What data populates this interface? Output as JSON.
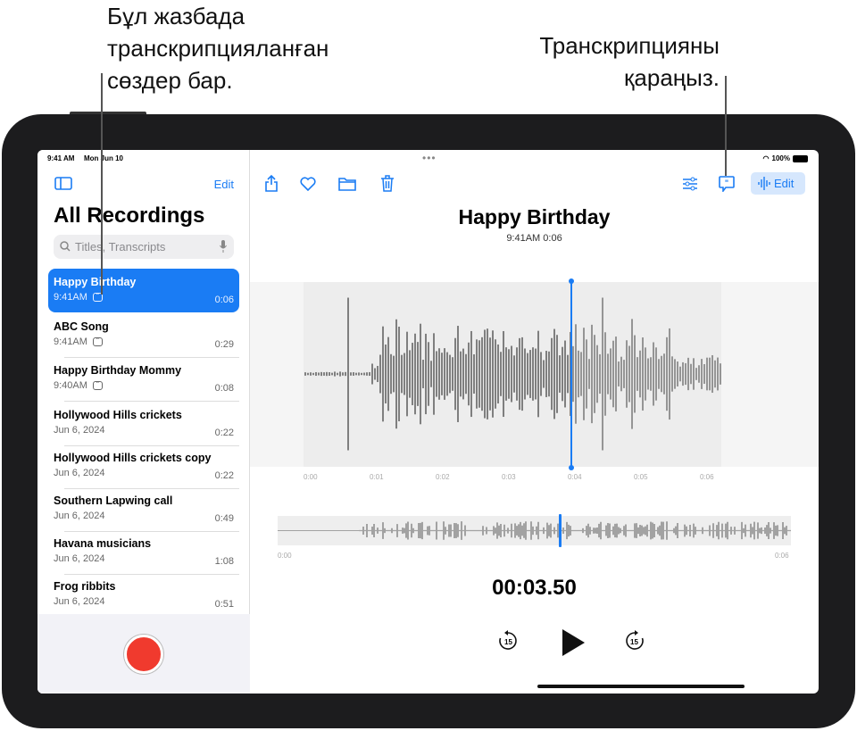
{
  "callouts": {
    "left": [
      "Бұл жазбада",
      "транскрипцияланған",
      "сөздер бар."
    ],
    "right": [
      "Транскрипцияны",
      "қараңыз."
    ]
  },
  "status": {
    "time": "9:41 AM",
    "date": "Mon Jun 10",
    "battery": "100%"
  },
  "sidebar": {
    "edit": "Edit",
    "title": "All Recordings",
    "search_placeholder": "Titles, Transcripts",
    "items": [
      {
        "title": "Happy Birthday",
        "sub": "9:41AM",
        "duration": "0:06",
        "transcript": true,
        "selected": true
      },
      {
        "title": "ABC Song",
        "sub": "9:41AM",
        "duration": "0:29",
        "transcript": true
      },
      {
        "title": "Happy Birthday Mommy",
        "sub": "9:40AM",
        "duration": "0:08",
        "transcript": true
      },
      {
        "title": "Hollywood Hills crickets",
        "sub": "Jun 6, 2024",
        "duration": "0:22"
      },
      {
        "title": "Hollywood Hills crickets copy",
        "sub": "Jun 6, 2024",
        "duration": "0:22"
      },
      {
        "title": "Southern Lapwing call",
        "sub": "Jun 6, 2024",
        "duration": "0:49"
      },
      {
        "title": "Havana musicians",
        "sub": "Jun 6, 2024",
        "duration": "1:08"
      },
      {
        "title": "Frog ribbits",
        "sub": "Jun 6, 2024",
        "duration": "0:51"
      }
    ]
  },
  "main": {
    "edit": "Edit",
    "title": "Happy Birthday",
    "subtitle": "9:41AM  0:06",
    "ticks": [
      "0:00",
      "0:01",
      "0:02",
      "0:03",
      "0:04",
      "0:05",
      "0:06"
    ],
    "overview_start": "0:00",
    "overview_end": "0:06",
    "current_time": "00:03.50",
    "playhead_fraction": 0.58,
    "skip_seconds": "15"
  },
  "colors": {
    "accent": "#1a7cf4",
    "record": "#f03a2e"
  }
}
